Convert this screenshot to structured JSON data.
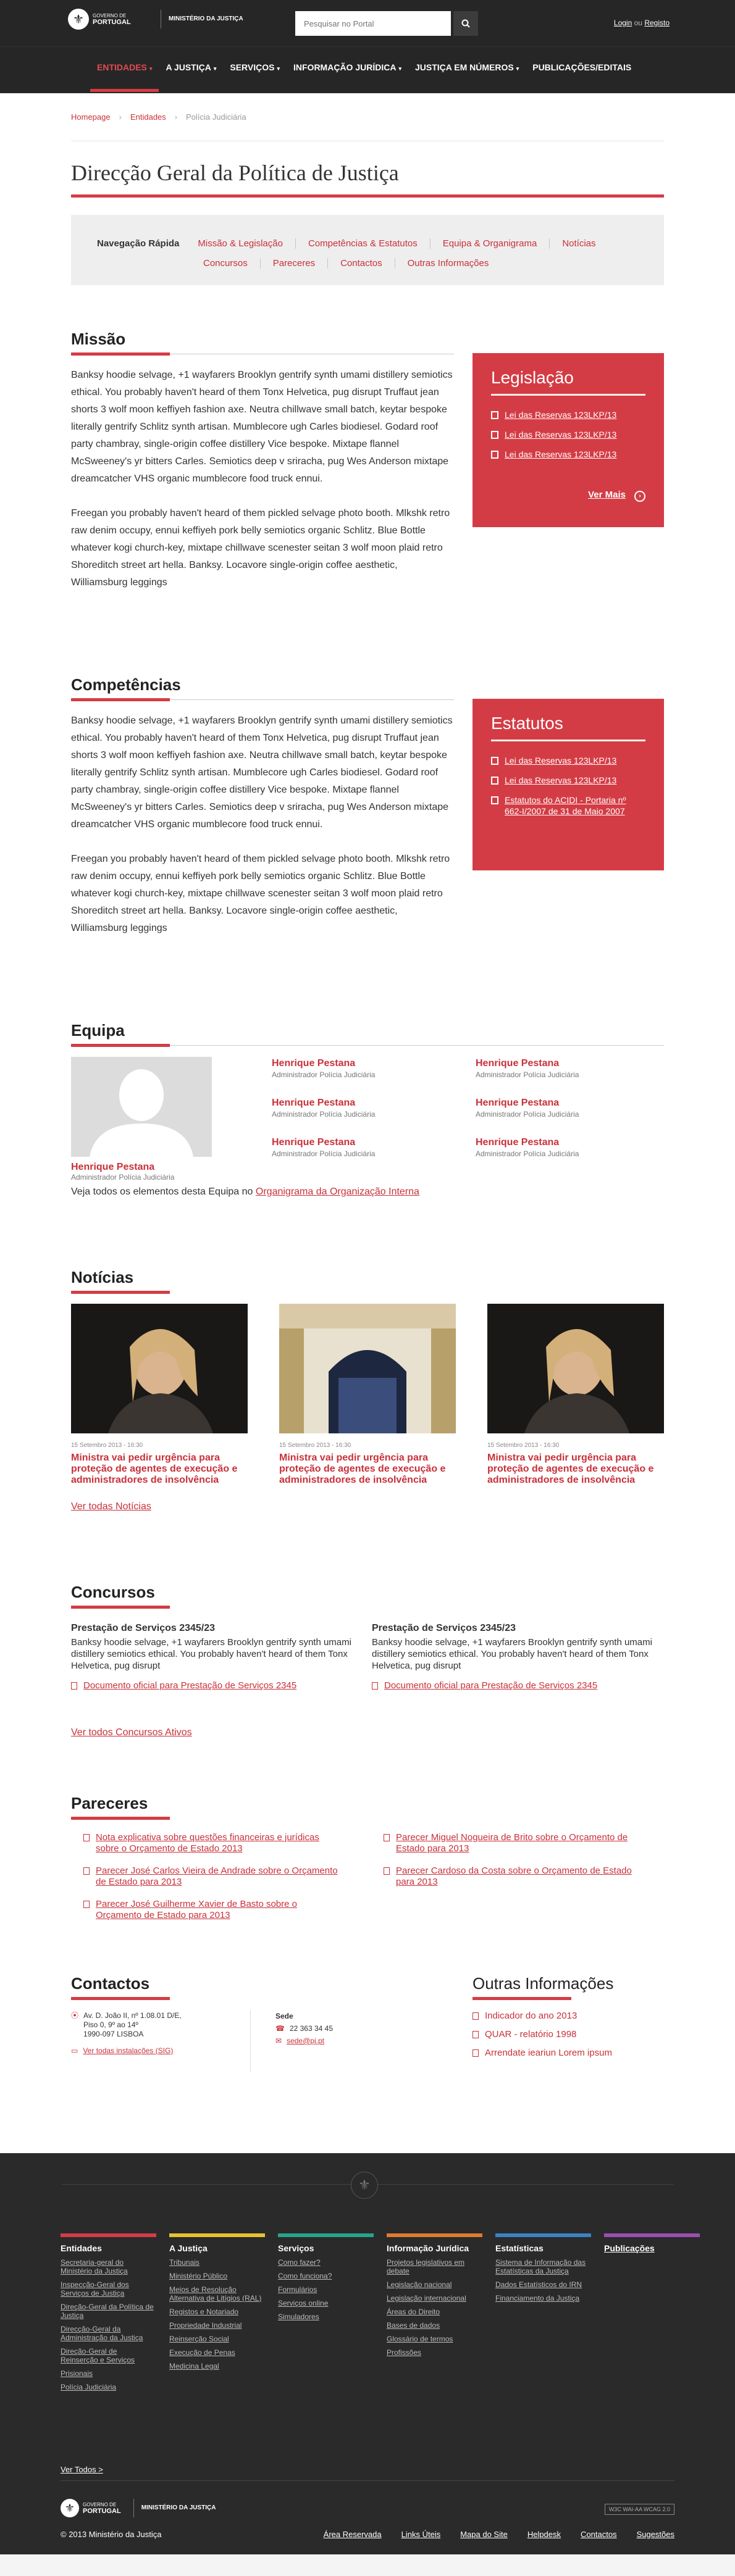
{
  "header": {
    "logo_line1": "GOVERNO DE",
    "logo_line2": "PORTUGAL",
    "ministry": "MINISTÉRIO DA JUSTIÇA",
    "search_placeholder": "Pesquisar no Portal",
    "login": "Login",
    "or": "ou",
    "register": "Registo"
  },
  "nav": [
    {
      "label": "ENTIDADES",
      "active": true,
      "chevron": true
    },
    {
      "label": "A JUSTIÇA",
      "chevron": true
    },
    {
      "label": "SERVIÇOS",
      "chevron": true
    },
    {
      "label": "INFORMAÇÃO JURÍDICA",
      "chevron": true
    },
    {
      "label": "JUSTIÇA EM NÚMEROS",
      "chevron": true
    },
    {
      "label": "PUBLICAÇÕES/EDITAIS",
      "chevron": false
    }
  ],
  "breadcrumb": [
    "Homepage",
    "Entidades",
    "Polícia Judiciária"
  ],
  "page_title": "Direcção Geral da Política de Justiça",
  "quicknav": {
    "title": "Navegação Rápida",
    "row1": [
      "Missão & Legislação",
      "Competências & Estatutos",
      "Equipa & Organigrama",
      "Notícias"
    ],
    "row2": [
      "Concursos",
      "Pareceres",
      "Contactos",
      "Outras Informações"
    ]
  },
  "missao": {
    "title": "Missão",
    "p1": "Banksy hoodie selvage, +1 wayfarers Brooklyn gentrify synth umami distillery semiotics ethical. You probably haven't heard of them Tonx Helvetica, pug disrupt Truffaut jean shorts 3 wolf moon keffiyeh fashion axe. Neutra chillwave small batch, keytar bespoke literally gentrify Schlitz synth artisan. Mumblecore ugh Carles biodiesel. Godard roof party chambray, single-origin coffee distillery Vice bespoke. Mixtape flannel McSweeney's yr bitters Carles. Semiotics deep v sriracha, pug Wes Anderson mixtape dreamcatcher VHS organic mumblecore food truck ennui.",
    "p2": "Freegan you probably haven't heard of them pickled selvage photo booth. Mlkshk retro raw denim occupy, ennui keffiyeh pork belly semiotics organic Schlitz. Blue Bottle whatever kogi church-key, mixtape chillwave scenester seitan 3 wolf moon plaid retro Shoreditch street art hella. Banksy. Locavore single-origin coffee aesthetic, Williamsburg leggings"
  },
  "legislacao": {
    "title": "Legislação",
    "items": [
      "Lei das Reservas 123LKP/13",
      "Lei das Reservas 123LKP/13",
      "Lei das Reservas 123LKP/13"
    ],
    "more": "Ver Mais"
  },
  "competencias": {
    "title": "Competências",
    "p1": "Banksy hoodie selvage, +1 wayfarers Brooklyn gentrify synth umami distillery semiotics ethical. You probably haven't heard of them Tonx Helvetica, pug disrupt Truffaut jean shorts 3 wolf moon keffiyeh fashion axe. Neutra chillwave small batch, keytar bespoke literally gentrify Schlitz synth artisan. Mumblecore ugh Carles biodiesel. Godard roof party chambray, single-origin coffee distillery Vice bespoke. Mixtape flannel McSweeney's yr bitters Carles. Semiotics deep v sriracha, pug Wes Anderson mixtape dreamcatcher VHS organic mumblecore food truck ennui.",
    "p2": "Freegan you probably haven't heard of them pickled selvage photo booth. Mlkshk retro raw denim occupy, ennui keffiyeh pork belly semiotics organic Schlitz. Blue Bottle whatever kogi church-key, mixtape chillwave scenester seitan 3 wolf moon plaid retro Shoreditch street art hella. Banksy. Locavore single-origin coffee aesthetic, Williamsburg leggings"
  },
  "estatutos": {
    "title": "Estatutos",
    "items": [
      "Lei das Reservas 123LKP/13",
      "Lei das Reservas 123LKP/13",
      "Estatutos do ACIDI - Portaria nº 662-I/2007 de 31 de Maio 2007"
    ]
  },
  "equipa": {
    "title": "Equipa",
    "lead": {
      "name": "Henrique Pestana",
      "role": "Administrador Polícia Judiciária"
    },
    "members": [
      {
        "name": "Henrique Pestana",
        "role": "Administrador Polícia Judiciária"
      },
      {
        "name": "Henrique Pestana",
        "role": "Administrador Polícia Judiciária"
      },
      {
        "name": "Henrique Pestana",
        "role": "Administrador Polícia Judiciária"
      },
      {
        "name": "Henrique Pestana",
        "role": "Administrador Polícia Judiciária"
      },
      {
        "name": "Henrique Pestana",
        "role": "Administrador Polícia Judiciária"
      },
      {
        "name": "Henrique Pestana",
        "role": "Administrador Polícia Judiciária"
      }
    ],
    "note": "Veja todos os elementos desta Equipa no",
    "note_link": "Organigrama da Organização Interna"
  },
  "noticias": {
    "title": "Notícias",
    "items": [
      {
        "date": "15 Setembro 2013 - 16:30",
        "title": "Ministra vai pedir urgência para proteção de agentes de execução e administradores de insolvência"
      },
      {
        "date": "15 Setembro 2013 - 16:30",
        "title": "Ministra vai pedir urgência para proteção de agentes de execução e administradores de insolvência"
      },
      {
        "date": "15 Setembro 2013 - 16:30",
        "title": "Ministra vai pedir urgência para proteção de agentes de execução e administradores de insolvência"
      }
    ],
    "all": "Ver todas Notícias"
  },
  "concursos": {
    "title": "Concursos",
    "items": [
      {
        "title": "Prestação de Serviços 2345/23",
        "text": "Banksy hoodie selvage, +1 wayfarers Brooklyn gentrify synth umami distillery semiotics ethical. You probably haven't heard of them Tonx Helvetica, pug disrupt",
        "doc": "Documento oficial para Prestação de Serviços 2345"
      },
      {
        "title": "Prestação de Serviços 2345/23",
        "text": "Banksy hoodie selvage, +1 wayfarers Brooklyn gentrify synth umami distillery semiotics ethical. You probably haven't heard of them Tonx Helvetica, pug disrupt",
        "doc": "Documento oficial para Prestação de Serviços 2345"
      }
    ],
    "all": "Ver todos Concursos Ativos"
  },
  "pareceres": {
    "title": "Pareceres",
    "left": [
      "Nota explicativa sobre questões financeiras e jurídicas sobre o Orçamento de Estado 2013",
      "Parecer José Carlos Vieira de Andrade sobre o Orçamento de Estado para 2013",
      "Parecer José Guilherme Xavier de Basto sobre o Orçamento de Estado para 2013"
    ],
    "right": [
      "Parecer Miguel Nogueira de Brito sobre o Orçamento de Estado para 2013",
      "Parecer Cardoso da Costa sobre o Orçamento de Estado para 2013"
    ]
  },
  "contactos": {
    "title": "Contactos",
    "address": [
      "Av. D. João II, nº 1.08.01 D/E,",
      "Piso 0, 9º ao 14º",
      "1990-097 LISBOA"
    ],
    "facilities": "Ver todas instalações (SIG)",
    "sede_label": "Sede",
    "phone": "22 363 34 45",
    "email": "sede@pj.pt"
  },
  "outras": {
    "title": "Outras Informações",
    "items": [
      "Indicador do ano 2013",
      "QUAR - relatório 1998",
      "Arrendate ieariun Lorem ipsum"
    ]
  },
  "footer": {
    "columns": [
      {
        "title": "Entidades",
        "color": "#d43c45",
        "links": [
          "Secretaria-geral do Ministério da Justiça",
          "Inspecção-Geral dos Serviços de Justiça",
          "Direção-Geral da Política de Justiça",
          "Direcção-Geral da Administração da Justiça",
          "Direção-Geral de Reinserção e Serviços",
          "Prisionais",
          "Polícia Judiciária"
        ]
      },
      {
        "title": "A Justiça",
        "color": "#e8c330",
        "links": [
          "Tribunais",
          "Ministério Público",
          "Meios de Resolução Alternativa de Litígios (RAL)",
          "Registos e Notariado",
          "Propriedade Industrial",
          "Reinserção Social",
          "Execução de Penas",
          "Medicina Legal"
        ]
      },
      {
        "title": "Serviços",
        "color": "#2aa38b",
        "links": [
          "Como fazer?",
          "Como funciona?",
          "Formulários",
          "Serviços online",
          "Simuladores"
        ]
      },
      {
        "title": "Informação Jurídica",
        "color": "#e07a2e",
        "links": [
          "Projetos legislativos em debate",
          "Legislação nacional",
          "Legislação internacional",
          "Áreas do Direito",
          "Bases de dados",
          "Glossário de termos",
          "Profissões"
        ]
      },
      {
        "title": "Estatísticas",
        "color": "#3a83c4",
        "links": [
          "Sistema de Informação das Estatísticas da Justiça",
          "Dados Estatísticos do IRN",
          "Financiamento da Justiça"
        ]
      },
      {
        "title": "Publicações",
        "color": "#9b4fb0",
        "links": []
      }
    ],
    "more": "Ver Todos >",
    "copyright": "© 2013 Ministério da Justiça",
    "bottom_links": [
      "Área Reservada",
      "Links Úteis",
      "Mapa do Site",
      "Helpdesk",
      "Contactos",
      "Sugestões"
    ],
    "w3c": "W3C WAI-AA WCAG 2.0"
  },
  "colors": {
    "accent": "#d43c45",
    "dark": "#262626"
  }
}
